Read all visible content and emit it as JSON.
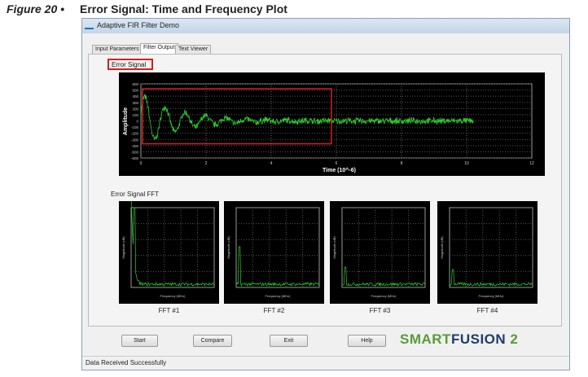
{
  "figure": {
    "number": "Figure 20 •",
    "title": "Error Signal: Time and Frequency Plot"
  },
  "window": {
    "title": "Adaptive FIR Filter Demo"
  },
  "tabs": [
    {
      "label": "Input Parameters"
    },
    {
      "label": "Filter Output"
    },
    {
      "label": "Text Viewer"
    }
  ],
  "active_tab": "Filter Output",
  "error_signal": {
    "label": "Error Signal"
  },
  "fft_section": {
    "label": "Error Signal FFT"
  },
  "fft_captions": [
    "FFT #1",
    "FFT #2",
    "FFT #3",
    "FFT #4"
  ],
  "buttons": {
    "start": "Start",
    "compare": "Compare",
    "exit": "Exit",
    "help": "Help"
  },
  "logo": {
    "text_a": "SMART",
    "text_b": "FUSION",
    "text_c": "2"
  },
  "status": "Data Received Successfully",
  "colors": {
    "signal": "#2ecc2e",
    "highlight": "#d52020",
    "plot_bg": "#000000"
  },
  "chart_data": [
    {
      "type": "line",
      "title": "Error Signal",
      "xlabel": "Time (10^-6)",
      "ylabel": "Amplitude",
      "xlim": [
        0,
        12
      ],
      "ylim": [
        -600,
        600
      ],
      "xticks": [
        "0",
        "2",
        "4",
        "6",
        "8",
        "10",
        "12"
      ],
      "yticks": [
        "600",
        "500",
        "400",
        "300",
        "200",
        "100",
        "0",
        "-100",
        "-200",
        "-300",
        "-400",
        "-500",
        "-600"
      ],
      "grid": true,
      "signal_end_x": 10.2,
      "initial_peak": 430,
      "initial_trough": -350,
      "steady_noise_amplitude": 60
    },
    {
      "type": "line",
      "title": "FFT",
      "xlabel": "Frequency (MHz)",
      "ylabel": "Magnitude (dB)",
      "panels": 4,
      "grid": true
    }
  ]
}
